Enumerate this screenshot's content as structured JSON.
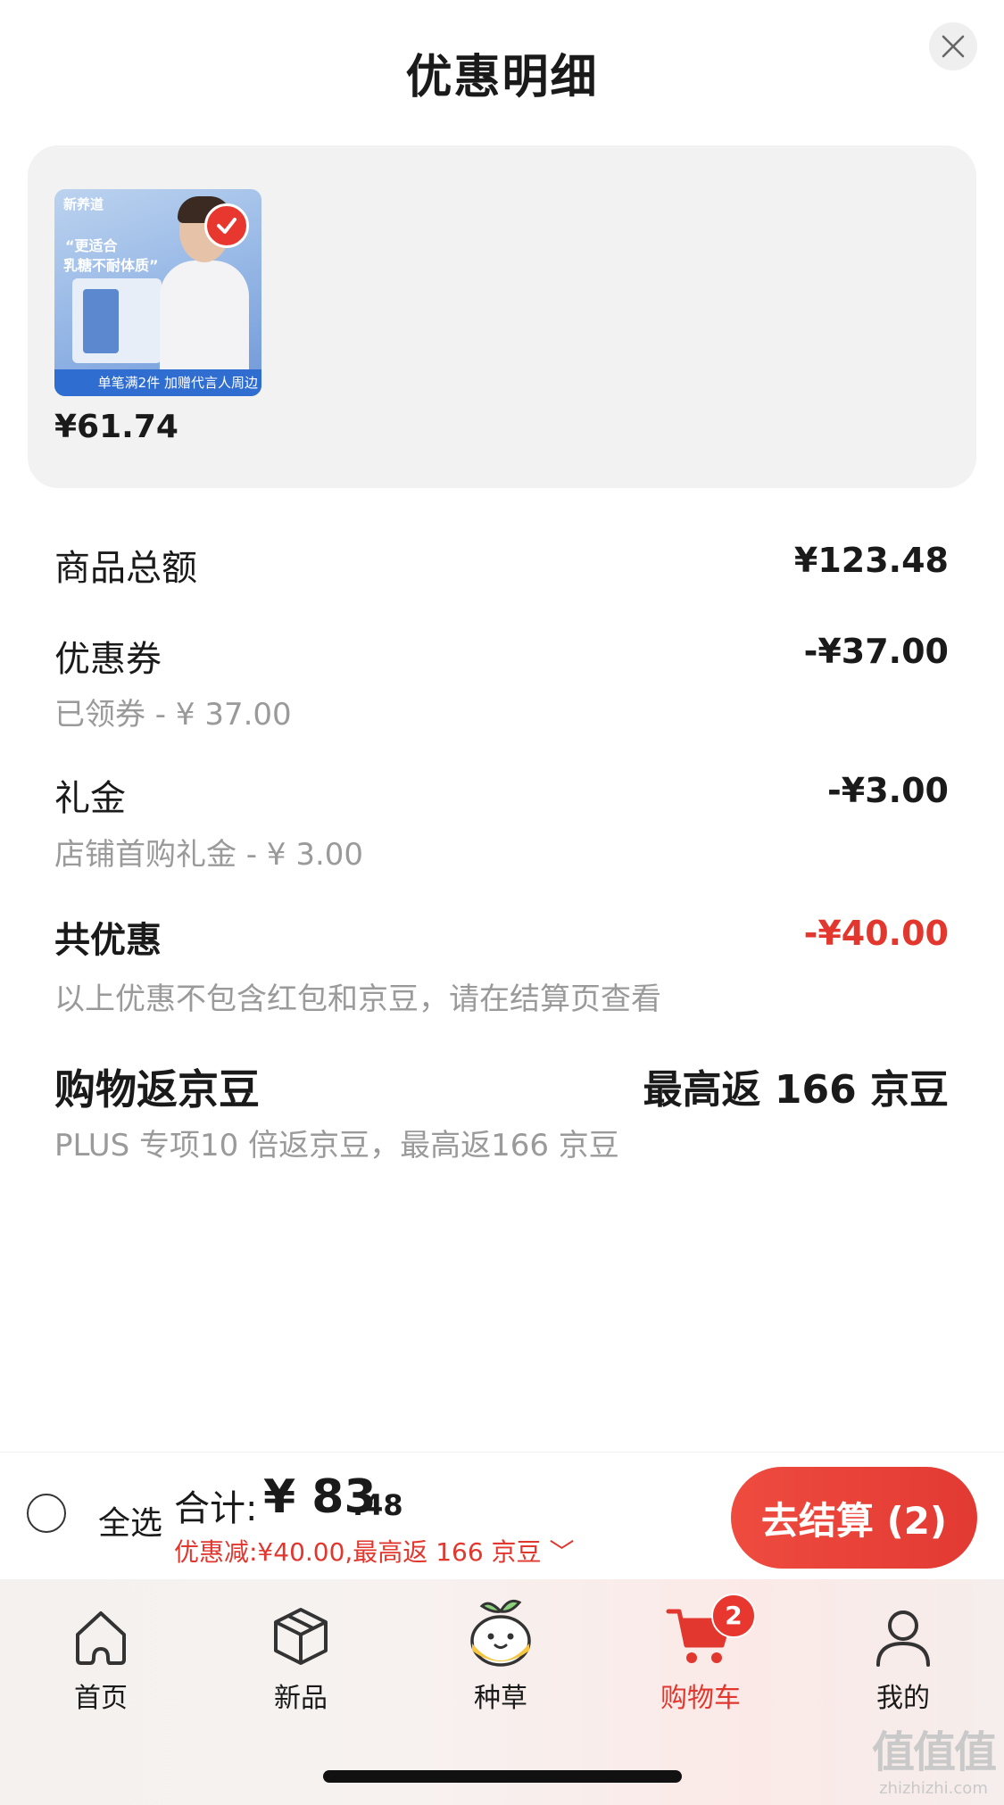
{
  "sheet": {
    "title": "优惠明细",
    "close_icon": "close-icon"
  },
  "product": {
    "image_brand": "新养道",
    "image_slogan_1": "“更适合",
    "image_slogan_2": "乳糖不耐体质”",
    "image_banner": "单笔满2件 加赠代言人周边",
    "price": "¥61.74"
  },
  "breakdown": {
    "goods_total_label": "商品总额",
    "goods_total_value": "¥123.48",
    "coupon_label": "优惠券",
    "coupon_value": "-¥37.00",
    "coupon_sub": "已领券 - ¥ 37.00",
    "gift_label": "礼金",
    "gift_value": "-¥3.00",
    "gift_sub": "店铺首购礼金 - ¥ 3.00",
    "total_discount_label": "共优惠",
    "total_discount_value": "-¥40.00",
    "total_discount_note": "以上优惠不包含红包和京豆，请在结算页查看",
    "beans_label": "购物返京豆",
    "beans_value": "最高返 166 京豆",
    "beans_sub": "PLUS 专项10 倍返京豆，最高返166 京豆"
  },
  "footer": {
    "select_all": "全选",
    "total_label": "合计:",
    "total_int": "¥ 83",
    "total_decimal": ".48",
    "discount_summary": "优惠减:¥40.00,最高返 166 京豆 ﹀",
    "checkout": "去结算 (2)"
  },
  "tabbar": {
    "items": [
      {
        "label": "首页",
        "icon": "home-icon"
      },
      {
        "label": "新品",
        "icon": "box-icon"
      },
      {
        "label": "种草",
        "icon": "sprout-mascot-icon"
      },
      {
        "label": "购物车",
        "icon": "cart-icon",
        "badge": "2",
        "active": true
      },
      {
        "label": "我的",
        "icon": "user-icon"
      }
    ]
  },
  "watermark": {
    "mark": "值值值",
    "site": "zhizhizhi.com"
  },
  "colors": {
    "accent_red": "#e2372e",
    "secondary_text": "#9a9a9a",
    "card_bg": "#f2f2f2"
  }
}
